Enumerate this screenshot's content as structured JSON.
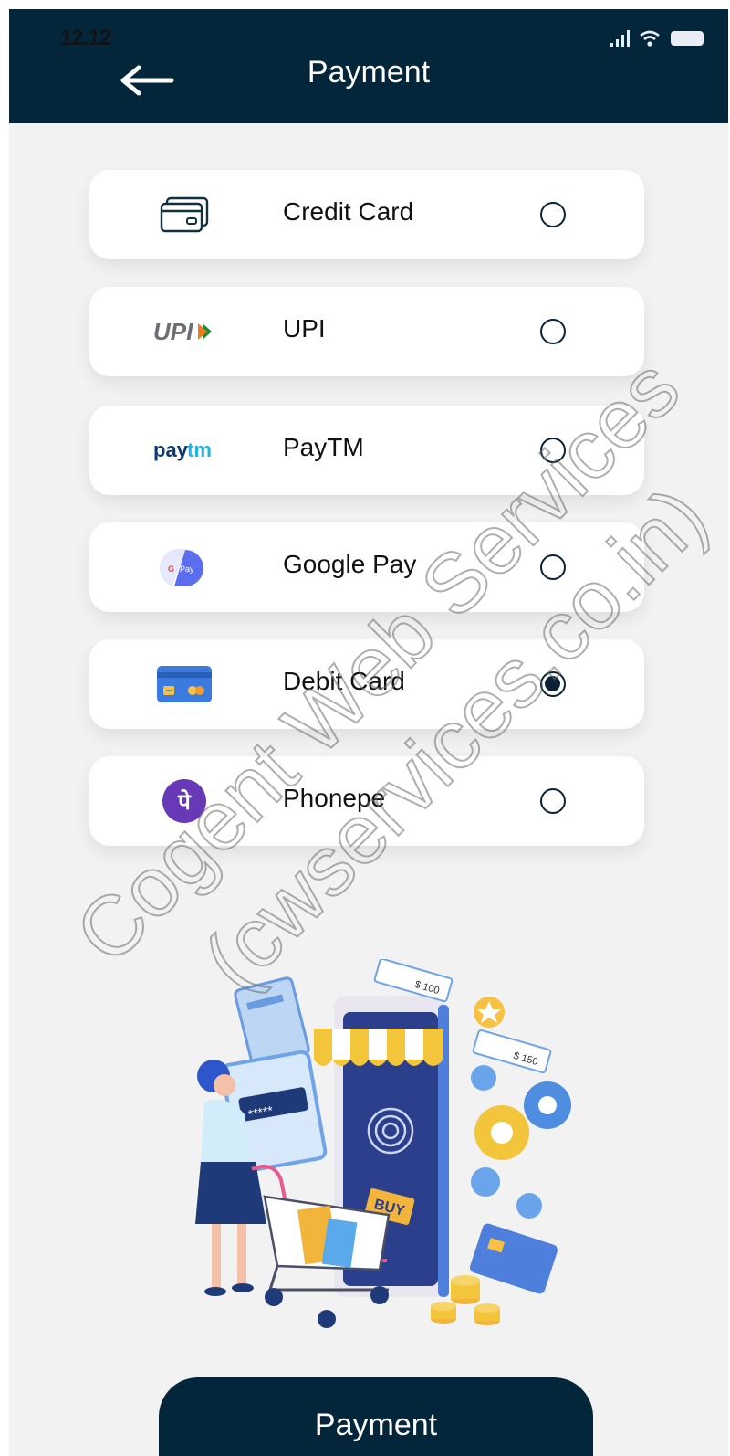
{
  "status_bar": {
    "time": "12.12"
  },
  "header": {
    "title": "Payment",
    "back_icon": "arrow-left-icon"
  },
  "payment_options": [
    {
      "id": "credit-card",
      "label": "Credit Card",
      "icon": "credit-card-icon",
      "selected": false
    },
    {
      "id": "upi",
      "label": "UPI",
      "icon": "upi-logo",
      "logo_text": "UPI",
      "selected": false
    },
    {
      "id": "paytm",
      "label": "PayTM",
      "icon": "paytm-logo",
      "logo_text_a": "pay",
      "logo_text_b": "tm",
      "selected": false
    },
    {
      "id": "google-pay",
      "label": "Google Pay",
      "icon": "google-pay-logo",
      "logo_text_a": "G",
      "logo_text_b": "Pay",
      "selected": false
    },
    {
      "id": "debit-card",
      "label": "Debit Card",
      "icon": "debit-card-icon",
      "selected": true
    },
    {
      "id": "phonepe",
      "label": "Phonepe",
      "icon": "phonepe-logo",
      "logo_text": "पे",
      "selected": false
    }
  ],
  "illustration": {
    "price_tag_1": "$ 100",
    "price_tag_2": "$ 150",
    "card_code": "*****",
    "buy_label": "BUY"
  },
  "footer": {
    "button_label": "Payment"
  },
  "watermark": {
    "line1": "Cogent Web Services",
    "line2": "(cwservices.co.in)"
  },
  "colors": {
    "primary": "#03263b",
    "background": "#f2f2f2",
    "card": "#ffffff"
  }
}
